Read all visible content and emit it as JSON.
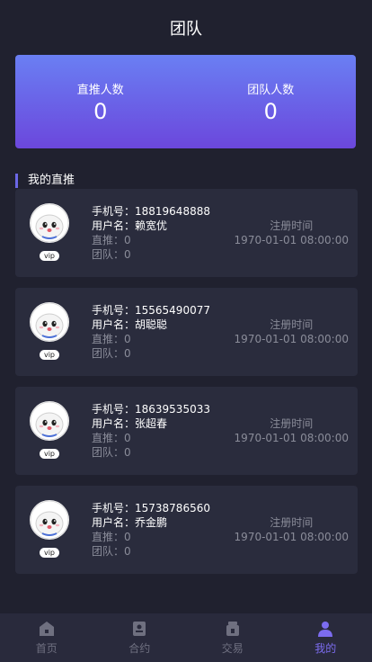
{
  "header": {
    "title": "团队"
  },
  "stats": {
    "direct_label": "直推人数",
    "direct_value": "0",
    "team_label": "团队人数",
    "team_value": "0"
  },
  "section": {
    "title": "我的直推"
  },
  "members": [
    {
      "phone": "手机号：18819648888",
      "username": "用户名：赖宽优",
      "direct": "直推：0",
      "team": "团队：0",
      "badge": "vip",
      "reg_label": "注册时间",
      "reg_time": "1970-01-01 08:00:00"
    },
    {
      "phone": "手机号：15565490077",
      "username": "用户名：胡聪聪",
      "direct": "直推：0",
      "team": "团队：0",
      "badge": "vip",
      "reg_label": "注册时间",
      "reg_time": "1970-01-01 08:00:00"
    },
    {
      "phone": "手机号：18639535033",
      "username": "用户名：张超春",
      "direct": "直推：0",
      "team": "团队：0",
      "badge": "vip",
      "reg_label": "注册时间",
      "reg_time": "1970-01-01 08:00:00"
    },
    {
      "phone": "手机号：15738786560",
      "username": "用户名：乔金鹏",
      "direct": "直推：0",
      "team": "团队：0",
      "badge": "vip",
      "reg_label": "注册时间",
      "reg_time": "1970-01-01 08:00:00"
    }
  ],
  "tabbar": {
    "items": [
      {
        "label": "首页",
        "icon": "home-icon",
        "active": false
      },
      {
        "label": "合约",
        "icon": "contract-icon",
        "active": false
      },
      {
        "label": "交易",
        "icon": "trade-icon",
        "active": false
      },
      {
        "label": "我的",
        "icon": "profile-icon",
        "active": true
      }
    ]
  },
  "colors": {
    "background": "#20212f",
    "card": "#2a2c3d",
    "accent": "#7c6cf0",
    "gradient_top": "#6a7ff3",
    "gradient_bottom": "#6b47dc"
  }
}
